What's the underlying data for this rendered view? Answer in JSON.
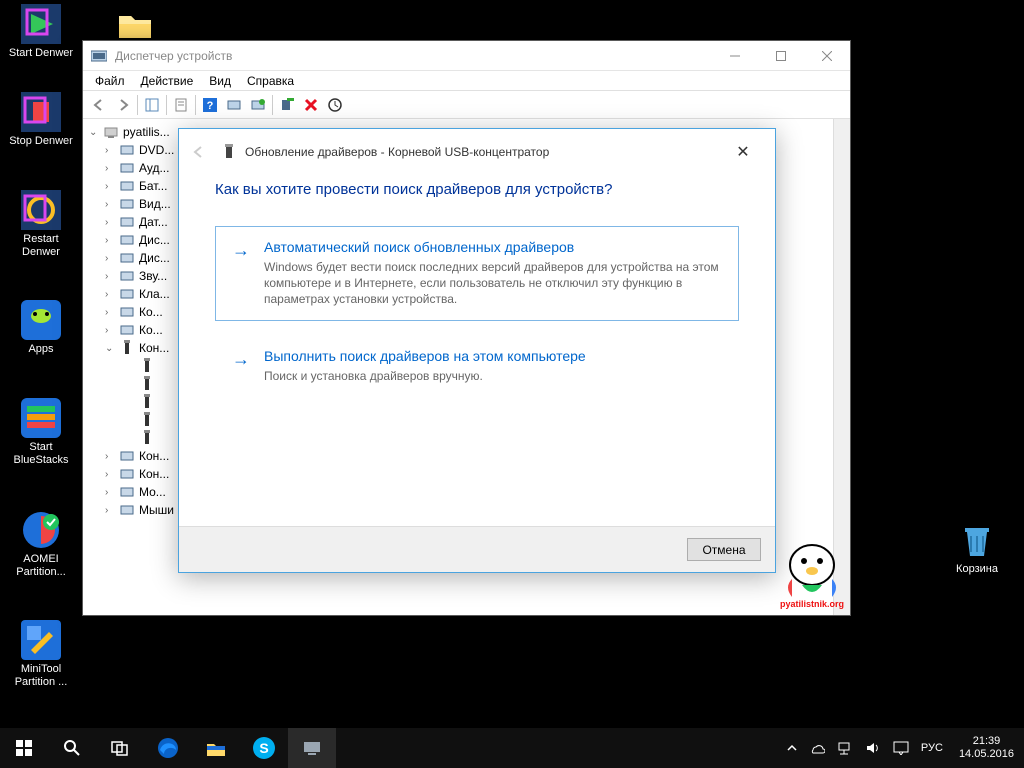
{
  "desktop": {
    "icons": [
      {
        "label": "Start Denwer"
      },
      {
        "label": "Stop Denwer"
      },
      {
        "label": "Restart Denwer"
      },
      {
        "label": "Apps"
      },
      {
        "label": "Start BlueStacks"
      },
      {
        "label": "AOMEI Partition..."
      },
      {
        "label": "MiniTool Partition ..."
      }
    ],
    "recycle": "Корзина"
  },
  "devmgr": {
    "title": "Диспетчер устройств",
    "menu": {
      "file": "Файл",
      "action": "Действие",
      "view": "Вид",
      "help": "Справка"
    },
    "tree": {
      "root": "pyatilis...",
      "nodes": [
        "DVD...",
        "Ауд...",
        "Бат...",
        "Вид...",
        "Дат...",
        "Дис...",
        "Дис...",
        "Зву...",
        "Кла...",
        "Ко...",
        "Ко...",
        "Кон..."
      ],
      "usbKids": 5,
      "tail": [
        "Кон...",
        "Кон...",
        "Мо...",
        "Мыши и иные указывающие устройства"
      ]
    }
  },
  "wizard": {
    "title": "Обновление драйверов - Корневой USB-концентратор",
    "question": "Как вы хотите провести поиск драйверов для устройств?",
    "opt1": {
      "title": "Автоматический поиск обновленных драйверов",
      "desc": "Windows будет вести поиск последних версий драйверов для устройства на этом компьютере и в Интернете, если пользователь не отключил эту функцию в параметрах установки устройства."
    },
    "opt2": {
      "title": "Выполнить поиск драйверов на этом компьютере",
      "desc": "Поиск и установка драйверов вручную."
    },
    "cancel": "Отмена"
  },
  "taskbar": {
    "lang": "РУС",
    "time": "21:39",
    "date": "14.05.2016"
  },
  "watermark": "pyatilistnik.org"
}
